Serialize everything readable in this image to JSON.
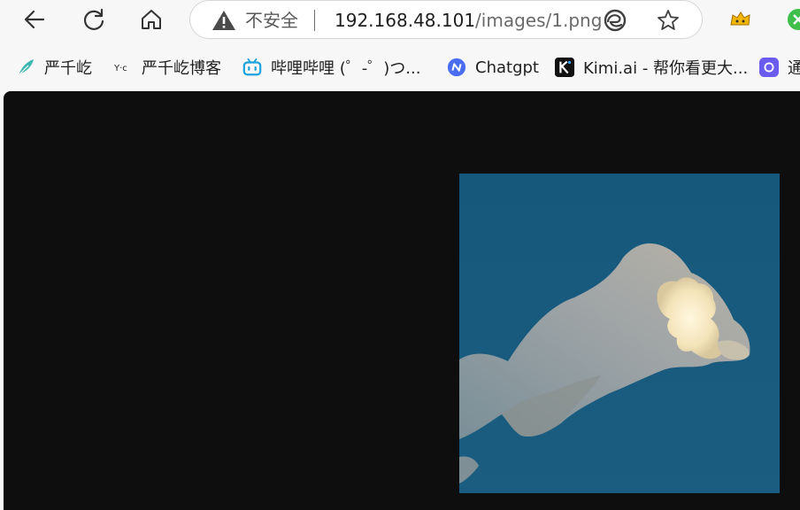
{
  "toolbar": {
    "security_label": "不安全",
    "url_host": "192.168.48.101",
    "url_path": "/images/1.png",
    "icons": [
      "back-icon",
      "reload-icon",
      "home-icon",
      "warning-icon",
      "edge-icon",
      "favorite-star-icon"
    ]
  },
  "bookmarks": [
    {
      "label": "严千屹",
      "icon": "feather-icon"
    },
    {
      "label": "严千屹博客",
      "icon": "blog-logo-icon"
    },
    {
      "label": "哔哩哔哩 (゜-゜)つ...",
      "icon": "bilibili-icon"
    },
    {
      "label": "Chatgpt",
      "icon": "chatgpt-icon"
    },
    {
      "label": "Kimi.ai - 帮你看更大...",
      "icon": "kimi-icon"
    },
    {
      "label": "通",
      "icon": "app-icon"
    }
  ],
  "content": {
    "image_description_hidden": "",
    "background_color": "#0e0e0e",
    "sky_color": "#175479"
  }
}
